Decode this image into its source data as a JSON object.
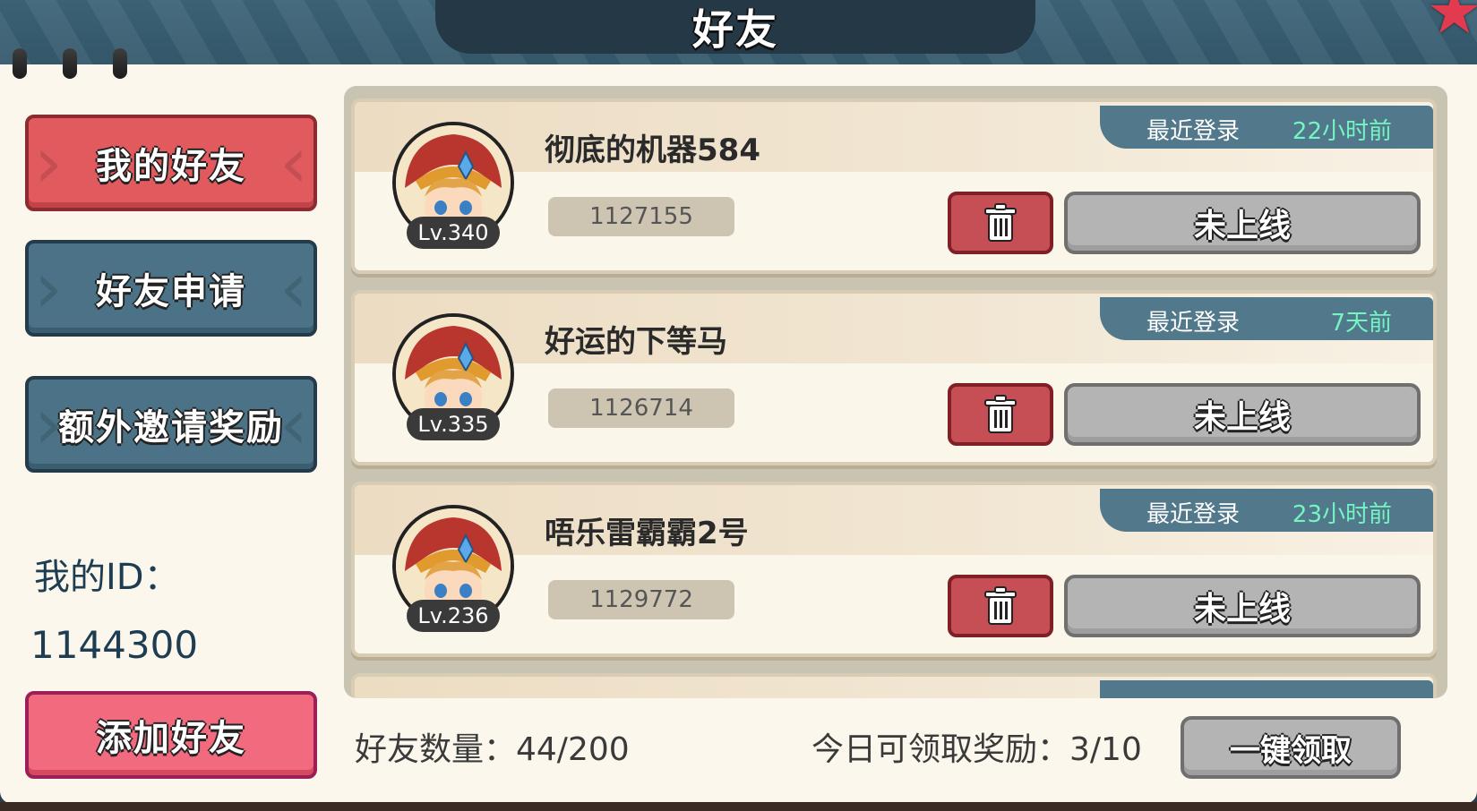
{
  "window": {
    "title": "好友"
  },
  "nav": {
    "items": [
      {
        "label": "我的好友",
        "active": true
      },
      {
        "label": "好友申请",
        "active": false
      },
      {
        "label": "额外邀请奖励",
        "active": false
      }
    ],
    "add_friend_label": "添加好友"
  },
  "my_id": {
    "label": "我的ID：",
    "value": "1144300"
  },
  "friends": [
    {
      "name": "彻底的机器584",
      "level": "Lv.340",
      "id": "1127155",
      "last_login_label": "最近登录",
      "last_login": "22小时前",
      "status": "未上线"
    },
    {
      "name": "好运的下等马",
      "level": "Lv.335",
      "id": "1126714",
      "last_login_label": "最近登录",
      "last_login": "7天前",
      "status": "未上线"
    },
    {
      "name": "唔乐雷霸霸2号",
      "level": "Lv.236",
      "id": "1129772",
      "last_login_label": "最近登录",
      "last_login": "23小时前",
      "status": "未上线"
    }
  ],
  "footer": {
    "friend_count": "好友数量：44/200",
    "daily_reward": "今日可领取奖励：3/10",
    "claim_all_label": "一键领取"
  },
  "colors": {
    "active_tab": "#e05a5e",
    "inactive_tab": "#4b7286",
    "add_button": "#f26a7d",
    "delete_button": "#c54f54",
    "offline_button": "#b4b4b4",
    "last_login_time": "#74f5c1"
  },
  "icons": [
    "close-star-icon",
    "trash-icon",
    "avatar-portrait"
  ]
}
